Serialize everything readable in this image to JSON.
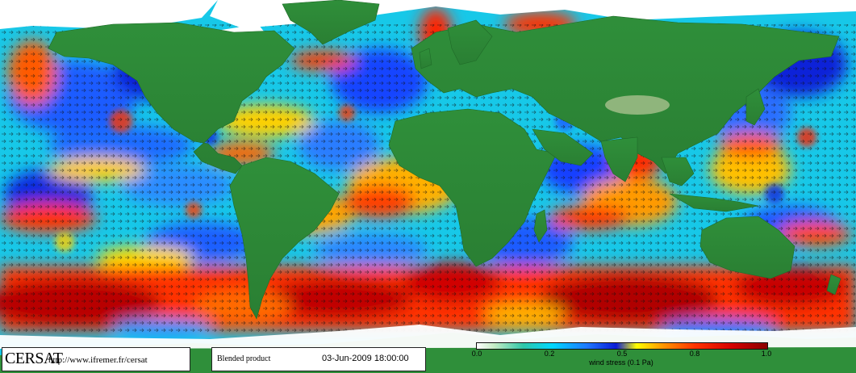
{
  "brand": "CERSAT",
  "url": "http://www.ifremer.fr/cersat",
  "product": "Blended product",
  "datetime": "03-Jun-2009 18:00:00",
  "colorbar": {
    "ticks": [
      "0.0",
      "0.2",
      "0.5",
      "0.8",
      "1.0"
    ],
    "label": "wind stress (0.1 Pa)"
  },
  "colors": {
    "land": "#2f8f3a",
    "ice": "#ffffff",
    "low": "#1f6bff",
    "mid": "#00e0ff",
    "high": "#ff2a00",
    "extreme": "#a00000"
  }
}
